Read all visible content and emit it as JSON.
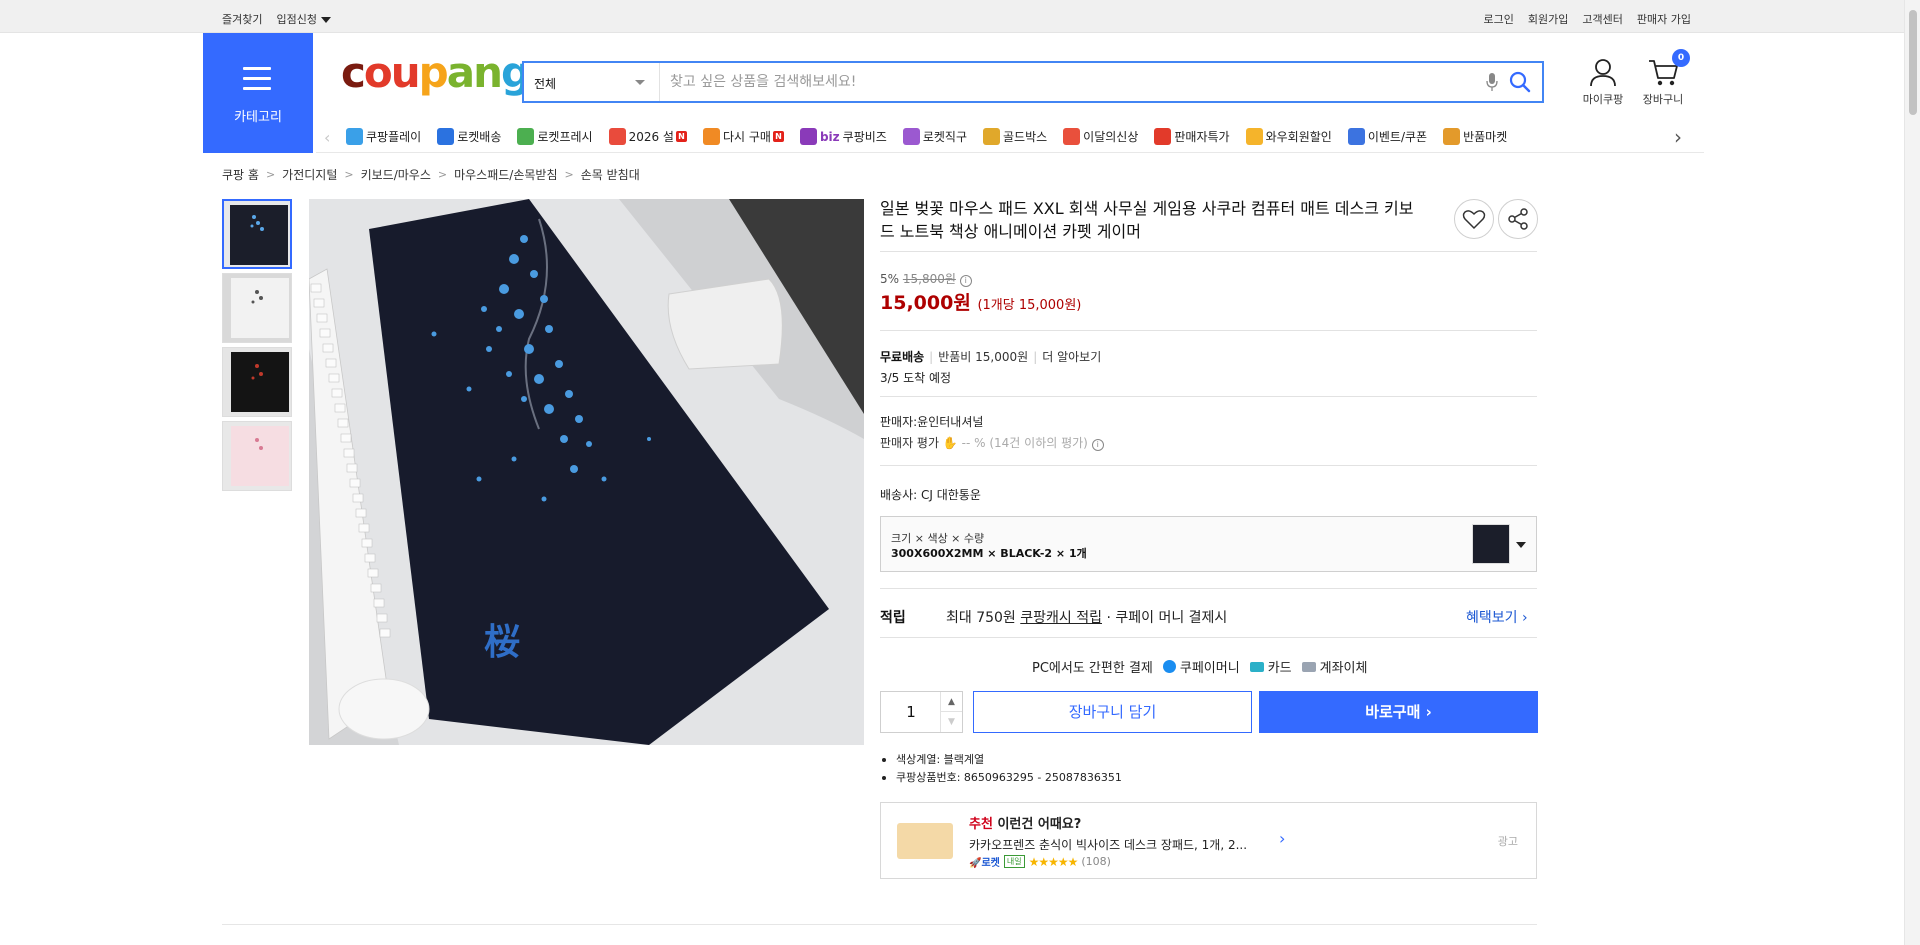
{
  "topbar": {
    "bookmark": "즐겨찾기",
    "apply": "입점신청",
    "links": [
      "로그인",
      "회원가입",
      "고객센터",
      "판매자 가입"
    ]
  },
  "header": {
    "category_label": "카테고리",
    "logo_letters": [
      "c",
      "ou",
      "p",
      "an",
      "g"
    ],
    "search_scope": "전체",
    "search_placeholder": "찾고 싶은 상품을 검색해보세요!",
    "mycoupang": "마이쿠팡",
    "cart": "장바구니",
    "cart_count": "0"
  },
  "nav": {
    "items": [
      {
        "label": "쿠팡플레이",
        "icon": "play-icon",
        "color": "#3aa0e8"
      },
      {
        "label": "로켓배송",
        "icon": "rocket-icon",
        "color": "#2b72e0"
      },
      {
        "label": "로켓프레시",
        "icon": "rocket-fresh-icon",
        "color": "#4caf50"
      },
      {
        "label": "2026 설",
        "icon": "gift-icon",
        "color": "#e94b3c",
        "new": "N"
      },
      {
        "label": "다시 구매",
        "icon": "home-icon",
        "color": "#f08a24",
        "new": "N"
      },
      {
        "label": "쿠팡비즈",
        "icon": "biz-icon",
        "color": "#8a3ab9",
        "prefix": "biz"
      },
      {
        "label": "로켓직구",
        "icon": "globe-icon",
        "color": "#9b59d0"
      },
      {
        "label": "골드박스",
        "icon": "goldbox-icon",
        "color": "#e0a82b"
      },
      {
        "label": "이달의신상",
        "icon": "bag-icon",
        "color": "#e9503c"
      },
      {
        "label": "판매자특가",
        "icon": "percent-icon",
        "color": "#e23a2a"
      },
      {
        "label": "와우회원할인",
        "icon": "wow-icon",
        "color": "#f5b42b"
      },
      {
        "label": "이벤트/쿠폰",
        "icon": "coupon-icon",
        "color": "#3c73e0"
      },
      {
        "label": "반품마켓",
        "icon": "market-icon",
        "color": "#e39a2b"
      }
    ]
  },
  "breadcrumb": [
    "쿠팡 홈",
    "가전디지털",
    "키보드/마우스",
    "마우스패드/손목받침",
    "손목 받침대"
  ],
  "product": {
    "title": "일본 벚꽃 마우스 패드 XXL 회색 사무실 게임용 사쿠라 컴퓨터 매트 데스크 키보드 노트북 책상 애니메이션 카펫 게이머",
    "discount": "5%",
    "original_price": "15,800원",
    "price": "15,000원",
    "unit_price": "(1개당 15,000원)",
    "shipping_free": "무료배송",
    "return_fee": "반품비 15,000원",
    "learn_more": "더 알아보기",
    "arrival": "3/5 도착 예정",
    "seller": "판매자:윤인터내셔널",
    "seller_rating_label": "판매자 평가",
    "seller_rating_value": "-- %",
    "seller_rating_note": "(14건 이하의 평가)",
    "carrier": "배송사:  CJ 대한통운",
    "option_header": "크기 × 색상 × 수량",
    "option_value": "300X600X2MM × BLACK-2 × 1개",
    "reward_label": "적립",
    "reward_text_1": "최대 750원",
    "reward_link": "쿠팡캐시 적립",
    "reward_text_2": "· 쿠페이 머니 결제시",
    "benefit_link": "혜택보기",
    "pay_label": "PC에서도 간편한 결제",
    "pay_methods": [
      "쿠페이머니",
      "카드",
      "계좌이체"
    ],
    "quantity": "1",
    "add_to_cart": "장바구니 담기",
    "buy_now": "바로구매",
    "specs": [
      "색상계열: 블랙계열",
      "쿠팡상품번호: 8650963295 - 25087836351"
    ]
  },
  "recommend": {
    "heading_em": "추천",
    "heading_rest": " 이런건 어때요?",
    "product": "카카오프렌즈 춘식이 빅사이즈 데스크 장패드, 1개, 2...",
    "rocket": "로켓",
    "tomorrow": "내일",
    "stars": "★★★★★",
    "reviews": "(108)",
    "ad": "광고"
  }
}
